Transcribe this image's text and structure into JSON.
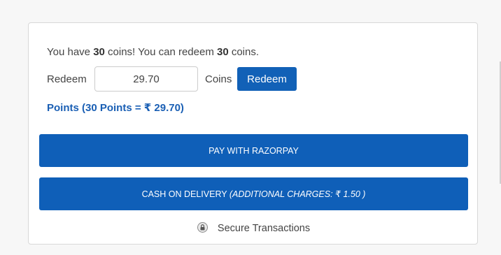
{
  "wallet": {
    "prefix": "You have ",
    "coins_have": "30",
    "middle": " coins! You can redeem ",
    "coins_redeemable": "30",
    "suffix": " coins."
  },
  "redeem": {
    "label": "Redeem",
    "input_value": "29.70",
    "unit_label": "Coins",
    "button_label": "Redeem"
  },
  "points": {
    "text": "Points (30 Points = ₹ 29.70)"
  },
  "payment": {
    "razorpay_label": "PAY WITH RAZORPAY",
    "cod_label": "CASH ON DELIVERY ",
    "cod_charges": "(ADDITIONAL CHARGES: ₹ 1.50 )"
  },
  "footer": {
    "secure_text": "Secure Transactions",
    "icon": "lock-icon"
  },
  "colors": {
    "primary_blue": "#1261b7",
    "points_text": "#1a5fb4",
    "card_border": "#d8d8d8",
    "page_bg": "#f7f7f7"
  }
}
